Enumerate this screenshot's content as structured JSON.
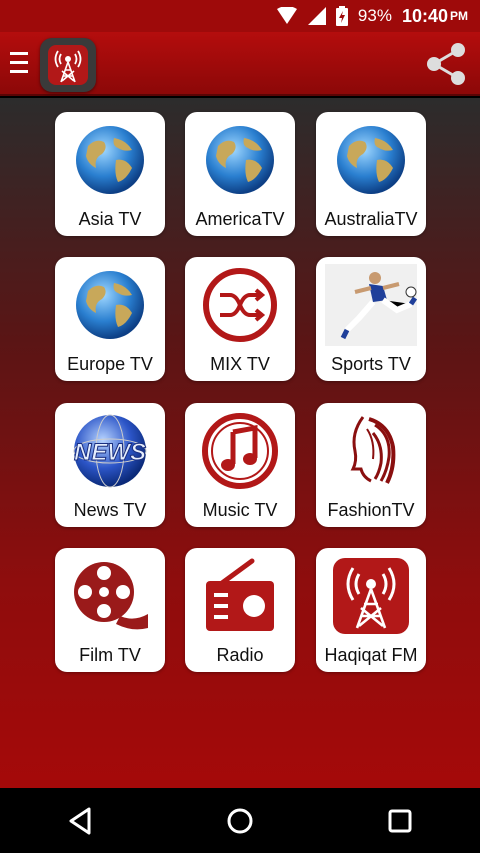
{
  "status_bar": {
    "battery": "93%",
    "time": "10:40",
    "ampm": "PM"
  },
  "app_bar": {
    "logo_icon": "radio-tower-icon",
    "share_icon": "share-icon",
    "menu_icon": "hamburger-menu-icon"
  },
  "tiles": [
    {
      "label": "Asia TV",
      "icon": "globe-icon"
    },
    {
      "label": "AmericaTV",
      "icon": "globe-icon"
    },
    {
      "label": "AustraliaTV",
      "icon": "globe-icon"
    },
    {
      "label": "Europe TV",
      "icon": "globe-icon"
    },
    {
      "label": "MIX TV",
      "icon": "shuffle-icon"
    },
    {
      "label": "Sports TV",
      "icon": "soccer-player-icon"
    },
    {
      "label": "News TV",
      "icon": "news-globe-icon"
    },
    {
      "label": "Music TV",
      "icon": "music-note-icon"
    },
    {
      "label": "FashionTV",
      "icon": "fashion-face-icon"
    },
    {
      "label": "Film TV",
      "icon": "film-reel-icon"
    },
    {
      "label": "Radio",
      "icon": "radio-icon"
    },
    {
      "label": "Haqiqat FM",
      "icon": "radio-tower-icon"
    }
  ],
  "colors": {
    "accent": "#b40d0d",
    "icon_red": "#b21818",
    "tile_bg": "#ffffff"
  }
}
